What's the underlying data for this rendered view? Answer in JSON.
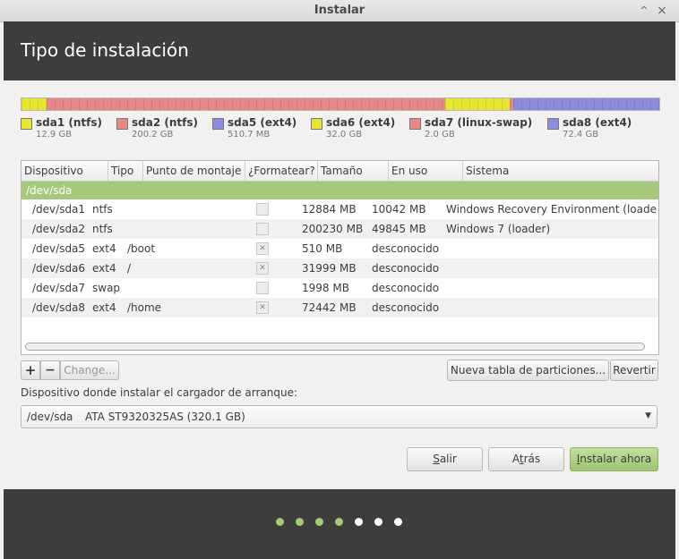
{
  "window": {
    "title": "Instalar",
    "minimize_icon": "^",
    "close_icon": "×"
  },
  "header": {
    "title": "Tipo de instalación"
  },
  "partition_bar": [
    {
      "color": "#e7e733",
      "fraction": 0.04
    },
    {
      "color": "#e48988",
      "fraction": 0.625
    },
    {
      "color": "#e7e733",
      "fraction": 0.1
    },
    {
      "color": "#e48988",
      "fraction": 0.006
    },
    {
      "color": "#8d8de0",
      "fraction": 0.229
    }
  ],
  "legend": [
    {
      "name": "sda1 (ntfs)",
      "size": "12.9 GB",
      "color": "#e7e733"
    },
    {
      "name": "sda2 (ntfs)",
      "size": "200.2 GB",
      "color": "#e48988"
    },
    {
      "name": "sda5 (ext4)",
      "size": "510.7 MB",
      "color": "#8d8de0"
    },
    {
      "name": "sda6 (ext4)",
      "size": "32.0 GB",
      "color": "#e7e733"
    },
    {
      "name": "sda7 (linux-swap)",
      "size": "2.0 GB",
      "color": "#e48988"
    },
    {
      "name": "sda8 (ext4)",
      "size": "72.4 GB",
      "color": "#8d8de0"
    }
  ],
  "table": {
    "columns": [
      "Dispositivo",
      "Tipo",
      "Punto de montaje",
      "¿Formatear?",
      "Tamaño",
      "En uso",
      "Sistema"
    ],
    "group": "/dev/sda",
    "rows": [
      {
        "device": "/dev/sda1",
        "type": "ntfs",
        "mount": "",
        "format": false,
        "size": "12884 MB",
        "used": "10042 MB",
        "system": "Windows Recovery Environment (loader)"
      },
      {
        "device": "/dev/sda2",
        "type": "ntfs",
        "mount": "",
        "format": false,
        "size": "200230 MB",
        "used": "49845 MB",
        "system": "Windows 7 (loader)"
      },
      {
        "device": "/dev/sda5",
        "type": "ext4",
        "mount": "/boot",
        "format": true,
        "size": "510 MB",
        "used": "desconocido",
        "system": ""
      },
      {
        "device": "/dev/sda6",
        "type": "ext4",
        "mount": "/",
        "format": true,
        "size": "31999 MB",
        "used": "desconocido",
        "system": ""
      },
      {
        "device": "/dev/sda7",
        "type": "swap",
        "mount": "",
        "format": false,
        "size": "1998 MB",
        "used": "desconocido",
        "system": ""
      },
      {
        "device": "/dev/sda8",
        "type": "ext4",
        "mount": "/home",
        "format": true,
        "size": "72442 MB",
        "used": "desconocido",
        "system": ""
      }
    ]
  },
  "toolbar": {
    "add": "+",
    "remove": "−",
    "change": "Change...",
    "new_table": "Nueva tabla de particiones...",
    "revert": "Revertir"
  },
  "bootloader": {
    "label": "Dispositivo donde instalar el cargador de arranque:",
    "device": "/dev/sda",
    "description": "ATA ST9320325AS (320.1 GB)"
  },
  "buttons": {
    "quit_mnemonic": "S",
    "quit_rest": "alir",
    "back_pre": "A",
    "back_mnemonic": "t",
    "back_rest": "rás",
    "install_mnemonic": "I",
    "install_rest": "nstalar ahora"
  },
  "progress": {
    "total_steps": 7,
    "completed_steps": 4,
    "done_color": "#a6c97b",
    "todo_color": "#ffffff"
  }
}
